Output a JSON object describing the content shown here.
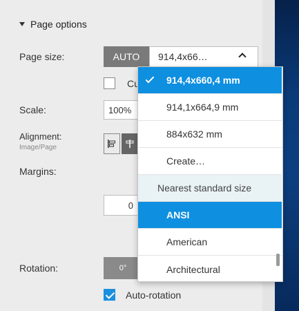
{
  "section": {
    "title": "Page options"
  },
  "page_size": {
    "label": "Page size:",
    "auto_label": "AUTO",
    "selected_value": "914,4x66…",
    "custom_checkbox_label": "Cu"
  },
  "scale": {
    "label": "Scale:",
    "value": "100%"
  },
  "alignment": {
    "label": "Alignment:",
    "sublabel": "Image/Page"
  },
  "margins": {
    "label": "Margins:",
    "value": "0"
  },
  "rotation": {
    "label": "Rotation:",
    "value": "0°"
  },
  "auto_rotation": {
    "label": "Auto-rotation",
    "checked": true
  },
  "dropdown": {
    "items": [
      {
        "label": "914,4x660,4 mm",
        "state": "selected"
      },
      {
        "label": "914,1x664,9 mm",
        "state": "normal"
      },
      {
        "label": "884x632 mm",
        "state": "normal"
      },
      {
        "label": "Create…",
        "state": "normal"
      },
      {
        "label": "Nearest standard size",
        "state": "group"
      },
      {
        "label": "ANSI",
        "state": "highlight"
      },
      {
        "label": "American",
        "state": "normal"
      },
      {
        "label": "Architectural",
        "state": "normal"
      }
    ]
  },
  "colors": {
    "accent": "#0e8fe0",
    "auto_button": "#7a7a7a",
    "panel_bg": "#ececec"
  }
}
